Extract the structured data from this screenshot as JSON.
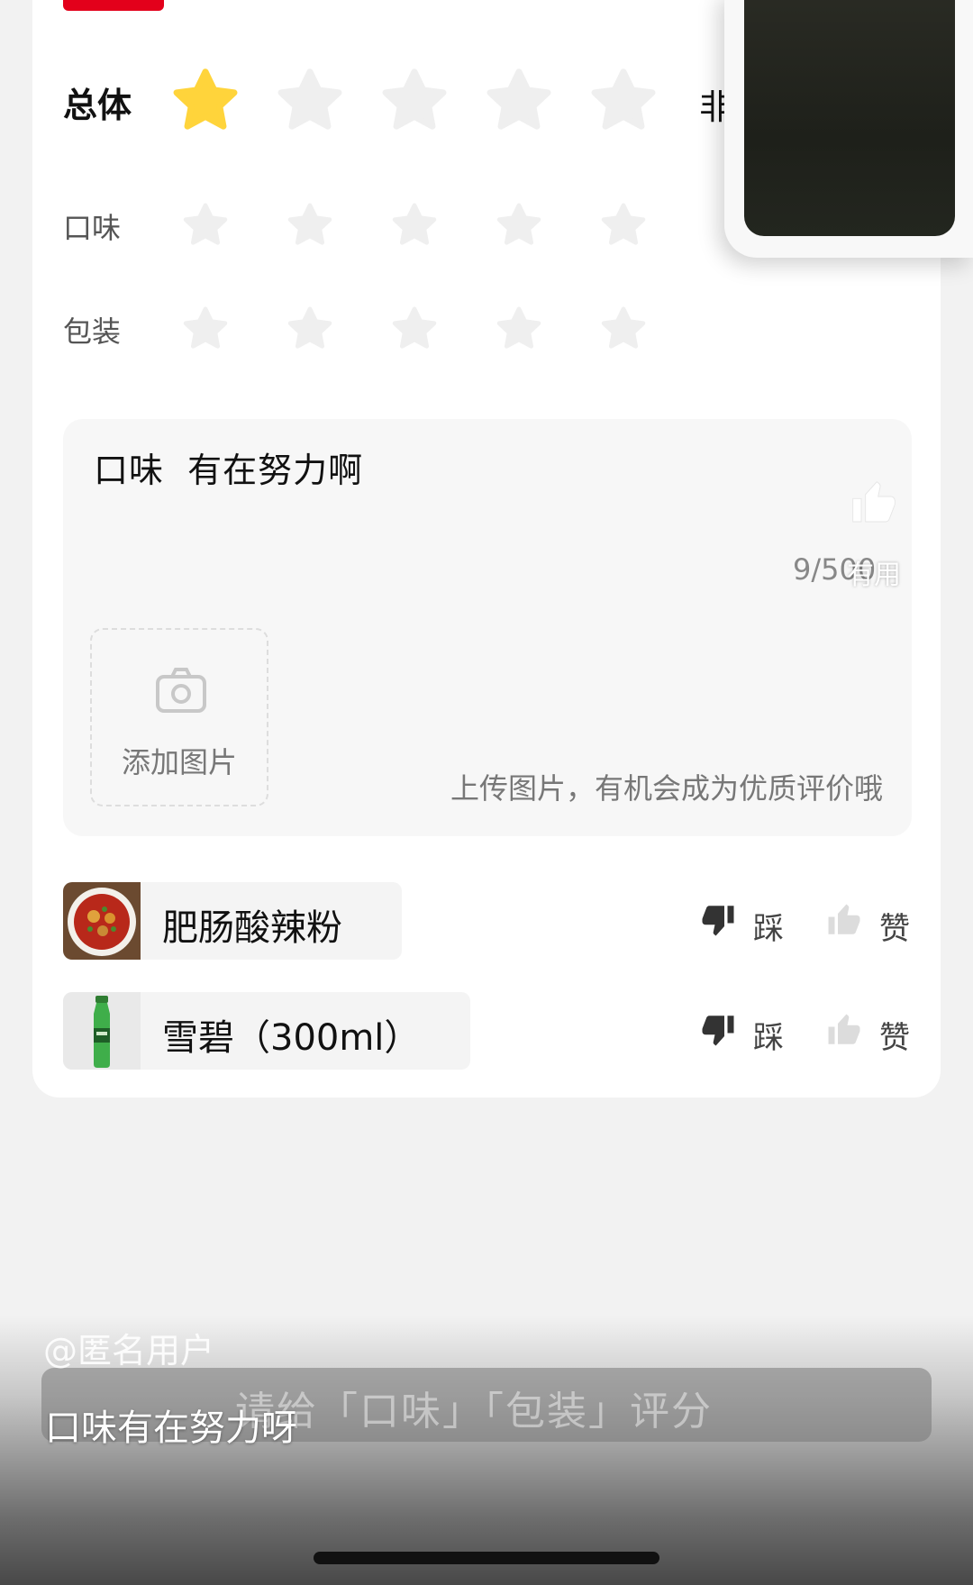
{
  "rating": {
    "overall_label": "总体",
    "overall_value": 1,
    "overall_max": 5,
    "overall_right_text": "非",
    "taste_label": "口味",
    "taste_value": 0,
    "packaging_label": "包装",
    "packaging_value": 0,
    "star_active_color": "#ffd43b",
    "star_inactive_color": "#efefef"
  },
  "review": {
    "text": "口味  有在努力啊",
    "char_count": "9/500",
    "useful_label": "有用",
    "add_photo_label": "添加图片",
    "upload_hint": "上传图片，有机会成为优质评价哦"
  },
  "dishes": [
    {
      "name": "肥肠酸辣粉",
      "dislike_label": "踩",
      "like_label": "赞"
    },
    {
      "name": "雪碧（300ml）",
      "dislike_label": "踩",
      "like_label": "赞"
    }
  ],
  "overlay": {
    "username": "@匿名用户",
    "toast": "请给「口味」「包装」评分",
    "caption": "口味有在努力呀"
  },
  "colors": {
    "brand_red": "#e3001b",
    "accent_star": "#ffd43b"
  },
  "icons": [
    "star-icon",
    "camera-icon",
    "thumbs-down-icon",
    "thumbs-up-icon"
  ]
}
